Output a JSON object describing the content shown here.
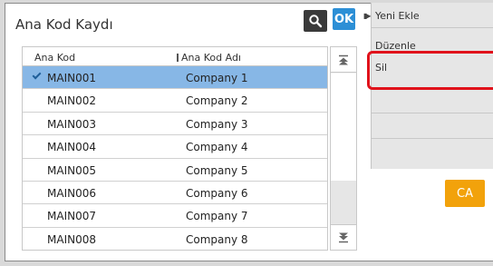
{
  "dialog": {
    "title": "Ana Kod Kaydı",
    "ok_label": "OK"
  },
  "table": {
    "headers": [
      "Ana Kod",
      "Ana Kod Adı"
    ],
    "rows": [
      {
        "code": "MAIN001",
        "name": "Company 1",
        "selected": true
      },
      {
        "code": "MAIN002",
        "name": "Company 2"
      },
      {
        "code": "MAIN003",
        "name": "Company 3"
      },
      {
        "code": "MAIN004",
        "name": "Company 4"
      },
      {
        "code": "MAIN005",
        "name": "Company 5"
      },
      {
        "code": "MAIN006",
        "name": "Company 6"
      },
      {
        "code": "MAIN007",
        "name": "Company 7"
      },
      {
        "code": "MAIN008",
        "name": "Company 8"
      }
    ]
  },
  "side_menu": {
    "items": [
      "Yeni Ekle",
      "Düzenle",
      "Sil"
    ]
  },
  "buttons": {
    "ca_label": "CA"
  },
  "icons": {
    "search": "search-icon",
    "scroll_up": "scroll-up-icon",
    "scroll_down": "scroll-down-icon",
    "sort_pin": "pin-icon",
    "expand": "expand-arrow-icon",
    "check": "check-icon"
  },
  "colors": {
    "ok": "#2c8fd6",
    "selected_row": "#87b7e6",
    "ca": "#f2a20b",
    "highlight": "#e0121b"
  }
}
